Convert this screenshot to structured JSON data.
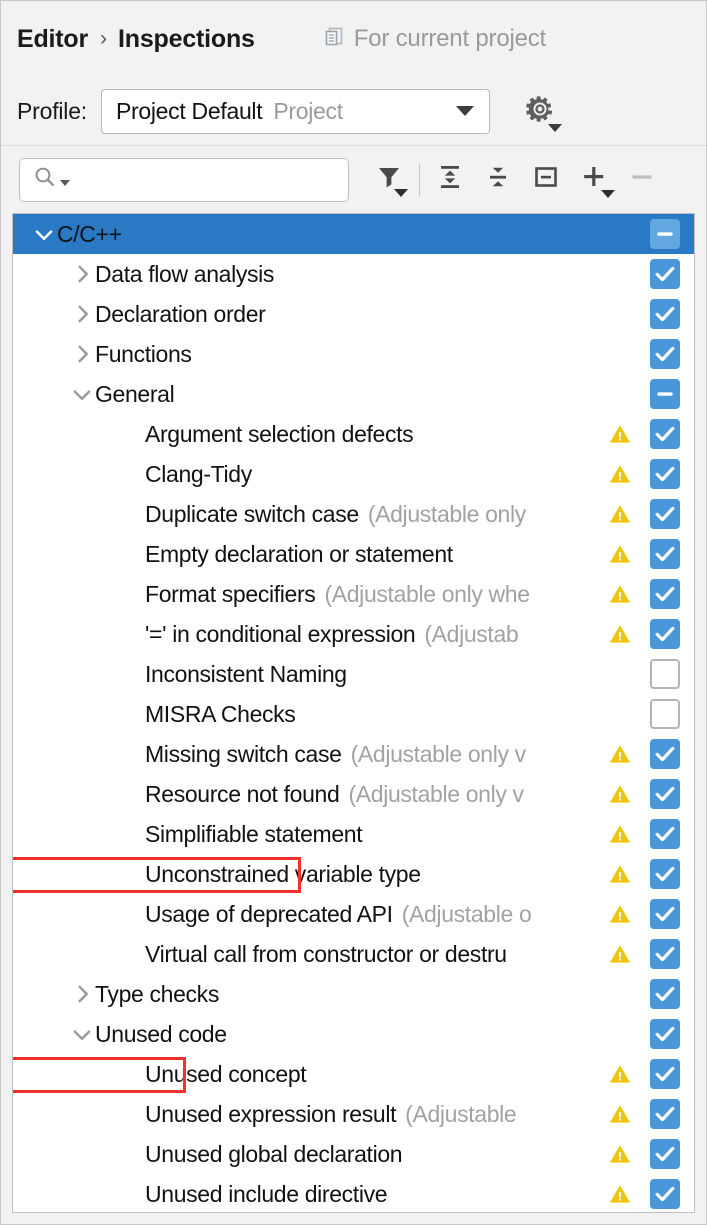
{
  "header": {
    "breadcrumb_root": "Editor",
    "breadcrumb_separator": "›",
    "breadcrumb_current": "Inspections",
    "scope_label": "For current project",
    "scope_icon": "project-scope-icon"
  },
  "profile": {
    "label": "Profile:",
    "selected_value": "Project Default",
    "selected_kind": "Project",
    "dropdown_icon": "chevron-down-icon",
    "settings_icon": "gear-dropdown-icon"
  },
  "toolbar": {
    "search_placeholder": "",
    "search_value": "",
    "search_icon": "search-dropdown-icon",
    "buttons": [
      {
        "name": "filter-button",
        "icon": "filter-dropdown-icon",
        "enabled": true
      },
      {
        "name": "expand-all-button",
        "icon": "expand-all-icon",
        "enabled": true
      },
      {
        "name": "collapse-all-button",
        "icon": "collapse-all-icon",
        "enabled": true
      },
      {
        "name": "collapse-node-button",
        "icon": "square-minus-icon",
        "enabled": true
      },
      {
        "name": "add-button",
        "icon": "plus-dropdown-icon",
        "enabled": true
      },
      {
        "name": "remove-button",
        "icon": "minus-icon",
        "enabled": false
      }
    ]
  },
  "colors": {
    "selection_blue": "#2a79c4",
    "checkbox_blue": "#4a96da",
    "warning_yellow": "#f0c410",
    "annotation_red": "#f4312f",
    "suffix_gray": "#a2a2a2"
  },
  "tree": {
    "rows": [
      {
        "label": "C/C++",
        "suffix": "",
        "level": 0,
        "group": true,
        "expanded": true,
        "twisty": "chevron-down-icon",
        "severity": null,
        "checkbox": "indeterminate",
        "selected": true,
        "annotated": false
      },
      {
        "label": "Data flow analysis",
        "suffix": "",
        "level": 1,
        "group": true,
        "expanded": false,
        "twisty": "chevron-right-icon",
        "severity": null,
        "checkbox": "checked",
        "selected": false,
        "annotated": false
      },
      {
        "label": "Declaration order",
        "suffix": "",
        "level": 1,
        "group": true,
        "expanded": false,
        "twisty": "chevron-right-icon",
        "severity": null,
        "checkbox": "checked",
        "selected": false,
        "annotated": false
      },
      {
        "label": "Functions",
        "suffix": "",
        "level": 1,
        "group": true,
        "expanded": false,
        "twisty": "chevron-right-icon",
        "severity": null,
        "checkbox": "checked",
        "selected": false,
        "annotated": false
      },
      {
        "label": "General",
        "suffix": "",
        "level": 1,
        "group": true,
        "expanded": true,
        "twisty": "chevron-down-icon",
        "severity": null,
        "checkbox": "indeterminate",
        "selected": false,
        "annotated": false
      },
      {
        "label": "Argument selection defects",
        "suffix": "",
        "level": 2,
        "group": false,
        "expanded": false,
        "twisty": null,
        "severity": "warning-icon",
        "checkbox": "checked",
        "selected": false,
        "annotated": false
      },
      {
        "label": "Clang-Tidy",
        "suffix": "",
        "level": 2,
        "group": false,
        "expanded": false,
        "twisty": null,
        "severity": "warning-icon",
        "checkbox": "checked",
        "selected": false,
        "annotated": false
      },
      {
        "label": "Duplicate switch case",
        "suffix": "(Adjustable only",
        "level": 2,
        "group": false,
        "expanded": false,
        "twisty": null,
        "severity": "warning-icon",
        "checkbox": "checked",
        "selected": false,
        "annotated": false
      },
      {
        "label": "Empty declaration or statement",
        "suffix": "",
        "level": 2,
        "group": false,
        "expanded": false,
        "twisty": null,
        "severity": "warning-icon",
        "checkbox": "checked",
        "selected": false,
        "annotated": false
      },
      {
        "label": "Format specifiers",
        "suffix": "(Adjustable only whe",
        "level": 2,
        "group": false,
        "expanded": false,
        "twisty": null,
        "severity": "warning-icon",
        "checkbox": "checked",
        "selected": false,
        "annotated": false
      },
      {
        "label": "'=' in conditional expression",
        "suffix": "(Adjustab",
        "level": 2,
        "group": false,
        "expanded": false,
        "twisty": null,
        "severity": "warning-icon",
        "checkbox": "checked",
        "selected": false,
        "annotated": false
      },
      {
        "label": "Inconsistent Naming",
        "suffix": "",
        "level": 2,
        "group": false,
        "expanded": false,
        "twisty": null,
        "severity": null,
        "checkbox": "unchecked",
        "selected": false,
        "annotated": false
      },
      {
        "label": "MISRA Checks",
        "suffix": "",
        "level": 2,
        "group": false,
        "expanded": false,
        "twisty": null,
        "severity": null,
        "checkbox": "unchecked",
        "selected": false,
        "annotated": false
      },
      {
        "label": "Missing switch case",
        "suffix": "(Adjustable only v",
        "level": 2,
        "group": false,
        "expanded": false,
        "twisty": null,
        "severity": "warning-icon",
        "checkbox": "checked",
        "selected": false,
        "annotated": false
      },
      {
        "label": "Resource not found",
        "suffix": "(Adjustable only v",
        "level": 2,
        "group": false,
        "expanded": false,
        "twisty": null,
        "severity": "warning-icon",
        "checkbox": "checked",
        "selected": false,
        "annotated": false
      },
      {
        "label": "Simplifiable statement",
        "suffix": "",
        "level": 2,
        "group": false,
        "expanded": false,
        "twisty": null,
        "severity": "warning-icon",
        "checkbox": "checked",
        "selected": false,
        "annotated": false
      },
      {
        "label": "Unconstrained variable type",
        "suffix": "",
        "level": 2,
        "group": false,
        "expanded": false,
        "twisty": null,
        "severity": "warning-icon",
        "checkbox": "checked",
        "selected": false,
        "annotated": true
      },
      {
        "label": "Usage of deprecated API",
        "suffix": "(Adjustable o",
        "level": 2,
        "group": false,
        "expanded": false,
        "twisty": null,
        "severity": "warning-icon",
        "checkbox": "checked",
        "selected": false,
        "annotated": false
      },
      {
        "label": "Virtual call from constructor or destru",
        "suffix": "",
        "level": 2,
        "group": false,
        "expanded": false,
        "twisty": null,
        "severity": "warning-icon",
        "checkbox": "checked",
        "selected": false,
        "annotated": false
      },
      {
        "label": "Type checks",
        "suffix": "",
        "level": 1,
        "group": true,
        "expanded": false,
        "twisty": "chevron-right-icon",
        "severity": null,
        "checkbox": "checked",
        "selected": false,
        "annotated": false
      },
      {
        "label": "Unused code",
        "suffix": "",
        "level": 1,
        "group": true,
        "expanded": true,
        "twisty": "chevron-down-icon",
        "severity": null,
        "checkbox": "checked",
        "selected": false,
        "annotated": false
      },
      {
        "label": "Unused concept",
        "suffix": "",
        "level": 2,
        "group": false,
        "expanded": false,
        "twisty": null,
        "severity": "warning-icon",
        "checkbox": "checked",
        "selected": false,
        "annotated": true
      },
      {
        "label": "Unused expression result",
        "suffix": "(Adjustable",
        "level": 2,
        "group": false,
        "expanded": false,
        "twisty": null,
        "severity": "warning-icon",
        "checkbox": "checked",
        "selected": false,
        "annotated": false
      },
      {
        "label": "Unused global declaration",
        "suffix": "",
        "level": 2,
        "group": false,
        "expanded": false,
        "twisty": null,
        "severity": "warning-icon",
        "checkbox": "checked",
        "selected": false,
        "annotated": false
      },
      {
        "label": "Unused include directive",
        "suffix": "",
        "level": 2,
        "group": false,
        "expanded": false,
        "twisty": null,
        "severity": "warning-icon",
        "checkbox": "checked",
        "selected": false,
        "annotated": false
      }
    ]
  }
}
